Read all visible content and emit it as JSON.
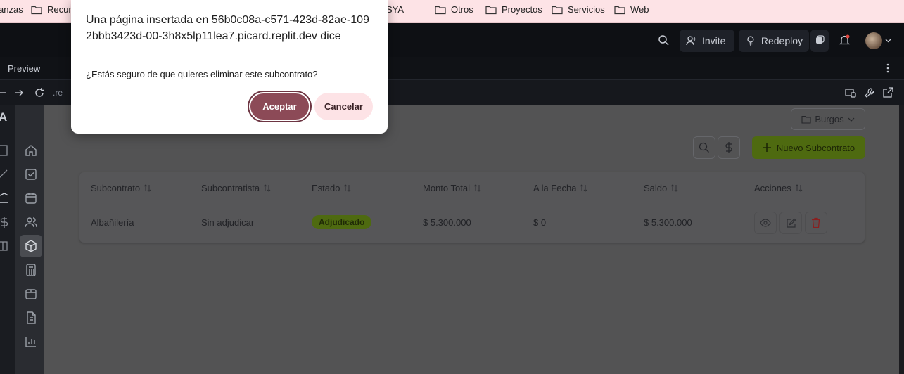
{
  "bookmarks": {
    "items": [
      {
        "label": "anzas"
      },
      {
        "label": "Recurs"
      },
      {
        "label": "SYA"
      },
      {
        "label": "Otros"
      },
      {
        "label": "Proyectos"
      },
      {
        "label": "Servicios"
      },
      {
        "label": "Web"
      }
    ]
  },
  "header": {
    "invite_label": "Invite",
    "redeploy_label": "Redeploy"
  },
  "tabs": {
    "preview_label": "Preview"
  },
  "urlbar": {
    "text": ".re"
  },
  "sidebar": {
    "logo_letter": "A"
  },
  "toolbar": {
    "location": "Burgos",
    "new_label": "Nuevo Subcontrato"
  },
  "table": {
    "columns": [
      "Subcontrato",
      "Subcontratista",
      "Estado",
      "Monto Total",
      "A la Fecha",
      "Saldo",
      "Acciones"
    ],
    "rows": [
      {
        "subcontrato": "Albañilería",
        "subcontratista": "Sin adjudicar",
        "estado": "Adjudicado",
        "monto_total": "$ 5.300.000",
        "a_la_fecha": "$ 0",
        "saldo": "$ 5.300.000"
      }
    ]
  },
  "dialog": {
    "title": "Una página insertada en 56b0c08a-c571-423d-82ae-1092bbb3423d-00-3h8x5lp11lea7.picard.replit.dev dice",
    "message": "¿Estás seguro de que quieres eliminar este subcontrato?",
    "ok_label": "Aceptar",
    "cancel_label": "Cancelar"
  },
  "colors": {
    "accent_green": "#4e6a10",
    "dialog_primary": "#8c4a57",
    "dialog_secondary": "#fde3e6",
    "delete_red": "#8a1f1f"
  }
}
